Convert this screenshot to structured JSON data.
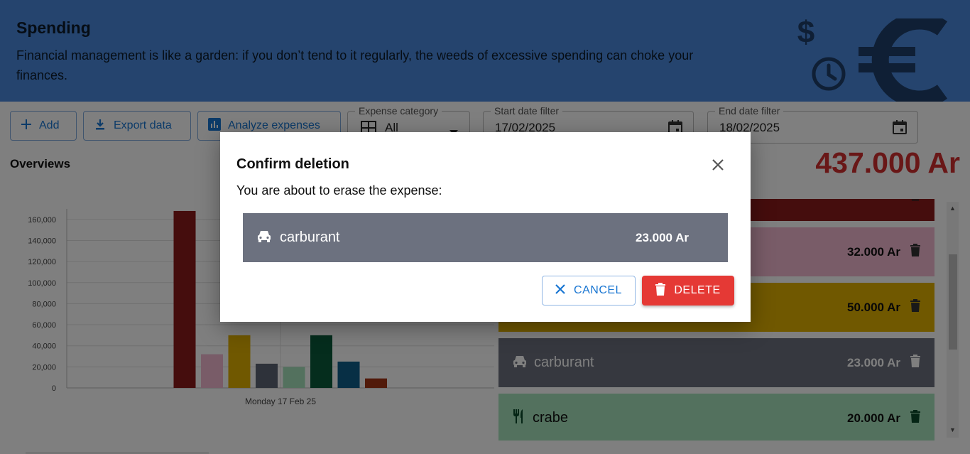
{
  "header": {
    "title": "Spending",
    "subtitle": "Financial management is like a garden: if you don’t tend to it regularly, the weeds of excessive spending can choke your finances."
  },
  "toolbar": {
    "add_label": "Add",
    "export_label": "Export data",
    "analyze_label": "Analyze expenses",
    "category": {
      "label": "Expense category",
      "value": "All"
    },
    "start_date": {
      "label": "Start date filter",
      "value": "17/02/2025"
    },
    "end_date": {
      "label": "End date filter",
      "value": "18/02/2025"
    }
  },
  "overview": {
    "title": "Overviews",
    "total": "437.000 Ar"
  },
  "chart_data": {
    "type": "bar",
    "categories": [
      "Monday 17 Feb 25"
    ],
    "series": [
      {
        "values": [
          168000
        ],
        "color": "#8b1a1a"
      },
      {
        "values": [
          32000
        ],
        "color": "#f2b8d0"
      },
      {
        "values": [
          50000
        ],
        "color": "#e0b000"
      },
      {
        "values": [
          23000
        ],
        "color": "#5d6475"
      },
      {
        "values": [
          20000
        ],
        "color": "#a6e3bd"
      },
      {
        "values": [
          50000
        ],
        "color": "#0a5a3a"
      },
      {
        "values": [
          25000
        ],
        "color": "#0e5e8a"
      },
      {
        "values": [
          9000
        ],
        "color": "#a33515"
      }
    ],
    "yticks": [
      "0",
      "20,000",
      "40,000",
      "60,000",
      "80,000",
      "100,000",
      "120,000",
      "140,000",
      "160,000"
    ],
    "ylim": [
      0,
      170000
    ],
    "grid": true
  },
  "expenses": [
    {
      "name": "",
      "amount": "",
      "color": "#8b1a1a"
    },
    {
      "name": "",
      "amount": "32.000 Ar",
      "color": "#f2b8d0"
    },
    {
      "name": "",
      "amount": "50.000 Ar",
      "color": "#e0b000"
    },
    {
      "name": "carburant",
      "amount": "23.000 Ar",
      "color": "#6c717f",
      "icon": "car-icon"
    },
    {
      "name": "crabe",
      "amount": "20.000 Ar",
      "color": "#a6e3bd",
      "icon": "fork-knife-icon"
    }
  ],
  "dialog": {
    "title": "Confirm deletion",
    "message": "You are about to erase the expense:",
    "expense": {
      "name": "carburant",
      "amount": "23.000 Ar",
      "icon": "car-icon"
    },
    "cancel_label": "CANCEL",
    "delete_label": "DELETE"
  }
}
